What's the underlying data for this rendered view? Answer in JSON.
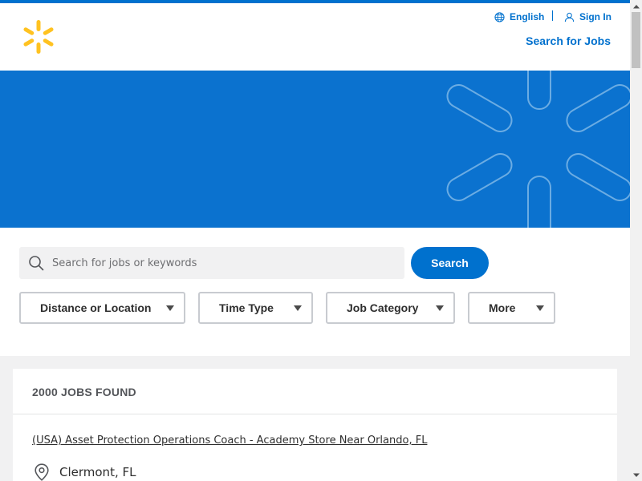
{
  "header": {
    "language_label": "English",
    "signin_label": "Sign In",
    "search_jobs_label": "Search for Jobs",
    "brand_color": "#ffc220",
    "accent_color": "#0071ce"
  },
  "search": {
    "placeholder": "Search for jobs or keywords",
    "value": "",
    "button_label": "Search"
  },
  "filters": [
    {
      "label": "Distance or Location"
    },
    {
      "label": "Time Type"
    },
    {
      "label": "Job Category"
    },
    {
      "label": "More"
    }
  ],
  "results": {
    "count_label": "2000 JOBS FOUND",
    "jobs": [
      {
        "title": "(USA) Asset Protection Operations Coach - Academy Store Near Orlando, FL",
        "location": "Clermont, FL"
      }
    ]
  },
  "icons": {
    "logo": "spark-logo-icon",
    "language": "globe-icon",
    "signin": "user-icon",
    "search": "search-icon",
    "location": "location-pin-icon",
    "dropdown": "caret-down-icon"
  }
}
